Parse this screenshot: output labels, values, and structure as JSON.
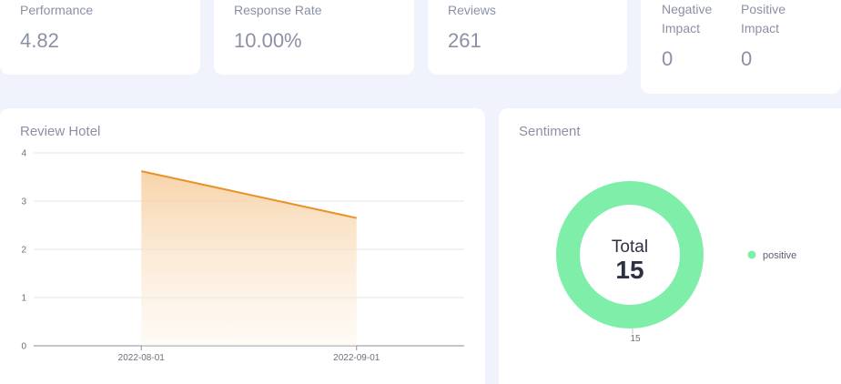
{
  "stats": [
    {
      "label": "Performance",
      "value": "4.82"
    },
    {
      "label": "Response Rate",
      "value": "10.00%"
    },
    {
      "label": "Reviews",
      "value": "261"
    }
  ],
  "impact": {
    "negative": {
      "label": "Negative Impact",
      "value": "0"
    },
    "positive": {
      "label": "Positive Impact",
      "value": "0"
    }
  },
  "review_panel": {
    "title": "Review Hotel"
  },
  "sentiment_panel": {
    "title": "Sentiment",
    "total_label": "Total",
    "total_value": "15",
    "slice_label": "15",
    "legend": [
      {
        "name": "positive",
        "color": "#7eeea8"
      }
    ]
  },
  "chart_data": [
    {
      "type": "area",
      "title": "Review Hotel",
      "x": [
        "2022-08-01",
        "2022-09-01"
      ],
      "series": [
        {
          "values": [
            3.62,
            2.65
          ]
        }
      ],
      "ylim": [
        0,
        4
      ],
      "yticks": [
        "0",
        "1",
        "2",
        "3",
        "4"
      ],
      "grid": true,
      "color": "#e8922a"
    },
    {
      "type": "pie",
      "title": "Sentiment",
      "categories": [
        "positive"
      ],
      "values": [
        15
      ],
      "legend": "right",
      "color": "#7eeea8"
    }
  ]
}
